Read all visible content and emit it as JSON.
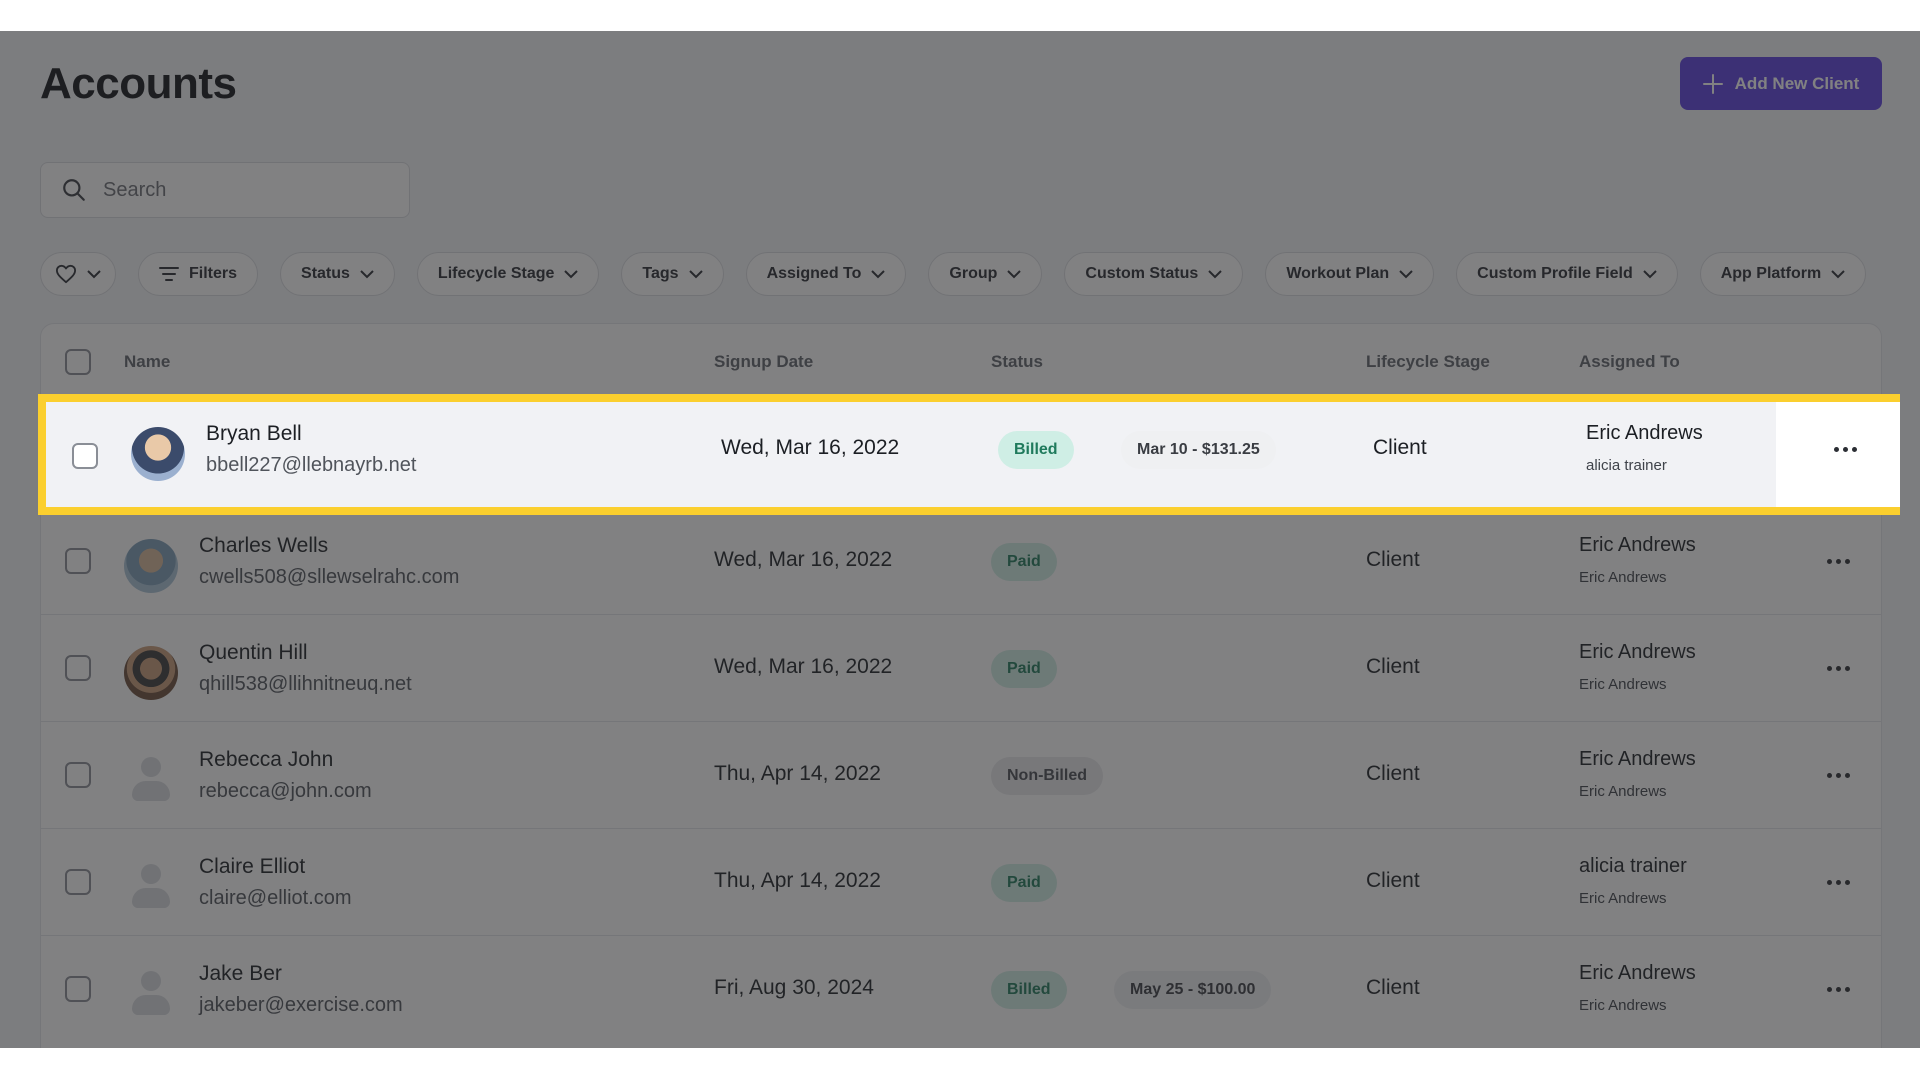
{
  "page": {
    "title": "Accounts",
    "add_button_label": "Add New Client"
  },
  "search": {
    "placeholder": "Search"
  },
  "filters": [
    {
      "label": "Filters"
    },
    {
      "label": "Status"
    },
    {
      "label": "Lifecycle Stage"
    },
    {
      "label": "Tags"
    },
    {
      "label": "Assigned To"
    },
    {
      "label": "Group"
    },
    {
      "label": "Custom Status"
    },
    {
      "label": "Workout Plan"
    },
    {
      "label": "Custom Profile Field"
    },
    {
      "label": "App Platform"
    }
  ],
  "table": {
    "headers": {
      "name": "Name",
      "signup_date": "Signup Date",
      "status": "Status",
      "lifecycle_stage": "Lifecycle Stage",
      "assigned_to": "Assigned To"
    },
    "rows": [
      {
        "name": "Bryan Bell",
        "email": "bbell227@llebnayrb.net",
        "signup": "Wed, Mar 16, 2022",
        "status": "Billed",
        "billing": "Mar 10 - $131.25",
        "stage": "Client",
        "assigned": "Eric Andrews",
        "assigned_sub": "alicia trainer",
        "avatar": "photo"
      },
      {
        "name": "Charles Wells",
        "email": "cwells508@sllewselrahc.com",
        "signup": "Wed, Mar 16, 2022",
        "status": "Paid",
        "billing": "",
        "stage": "Client",
        "assigned": "Eric Andrews",
        "assigned_sub": "Eric Andrews",
        "avatar": "photo"
      },
      {
        "name": "Quentin Hill",
        "email": "qhill538@llihnitneuq.net",
        "signup": "Wed, Mar 16, 2022",
        "status": "Paid",
        "billing": "",
        "stage": "Client",
        "assigned": "Eric Andrews",
        "assigned_sub": "Eric Andrews",
        "avatar": "photo"
      },
      {
        "name": "Rebecca John",
        "email": "rebecca@john.com",
        "signup": "Thu, Apr 14, 2022",
        "status": "Non-Billed",
        "billing": "",
        "stage": "Client",
        "assigned": "Eric Andrews",
        "assigned_sub": "Eric Andrews",
        "avatar": "placeholder"
      },
      {
        "name": "Claire Elliot",
        "email": "claire@elliot.com",
        "signup": "Thu, Apr 14, 2022",
        "status": "Paid",
        "billing": "",
        "stage": "Client",
        "assigned": "alicia trainer",
        "assigned_sub": "Eric Andrews",
        "avatar": "placeholder"
      },
      {
        "name": "Jake Ber",
        "email": "jakeber@exercise.com",
        "signup": "Fri, Aug 30, 2024",
        "status": "Billed",
        "billing": "May 25 - $100.00",
        "stage": "Client",
        "assigned": "Eric Andrews",
        "assigned_sub": "Eric Andrews",
        "avatar": "placeholder"
      }
    ]
  },
  "icons": {
    "add": "plus-icon",
    "search": "search-icon",
    "favorites": "heart-icon",
    "filters": "filter-lines-icon",
    "dropdown": "chevron-down-icon",
    "row_actions": "more-horizontal-icon"
  },
  "colors": {
    "accent": "#5b3fe0",
    "highlight_border": "#fbcf2e",
    "badge_green_bg": "#cfeee5",
    "badge_green_text": "#1f7a5c",
    "badge_gray_bg": "#e9eaed"
  }
}
